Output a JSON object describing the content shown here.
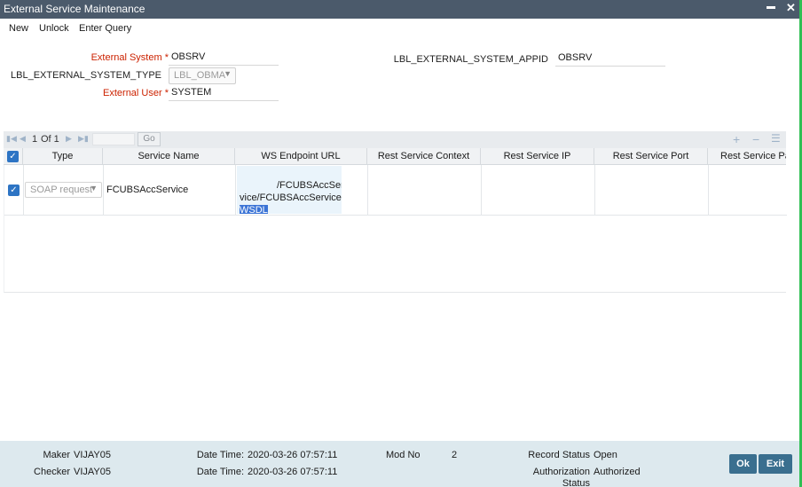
{
  "window": {
    "title": "External Service Maintenance",
    "minimize_glyph": "▬",
    "close_glyph": "✕"
  },
  "menu": {
    "new": "New",
    "unlock": "Unlock",
    "enter_query": "Enter Query"
  },
  "form": {
    "external_system_label": "External System",
    "external_system_value": "OBSRV",
    "system_type_label": "LBL_EXTERNAL_SYSTEM_TYPE",
    "system_type_value": "LBL_OBMA",
    "external_user_label": "External User",
    "external_user_value": "SYSTEM",
    "appid_label": "LBL_EXTERNAL_SYSTEM_APPID",
    "appid_value": "OBSRV",
    "required_marker": "*"
  },
  "grid": {
    "pager": {
      "current": "1",
      "of_text": "Of 1",
      "go_label": "Go"
    },
    "toolbar_icons": [
      "add-row-icon",
      "delete-row-icon",
      "view-list-icon"
    ],
    "columns": [
      "Type",
      "Service Name",
      "WS Endpoint URL",
      "Rest Service Context",
      "Rest Service IP",
      "Rest Service Port",
      "Rest Service Pat"
    ],
    "rows": [
      {
        "checked": true,
        "type": "SOAP request",
        "service_name": "FCUBSAccService",
        "url_line1": "/FCUBSAccSer",
        "url_line2": "vice/FCUBSAccService?",
        "url_line3": "WSDL",
        "rest_context": "",
        "rest_ip": "",
        "rest_port": "",
        "rest_path": ""
      }
    ]
  },
  "footer": {
    "maker_label": "Maker",
    "maker_value": "VIJAY05",
    "maker_dt_label": "Date Time:",
    "maker_dt_value": "2020-03-26 07:57:11",
    "checker_label": "Checker",
    "checker_value": "VIJAY05",
    "checker_dt_label": "Date Time:",
    "checker_dt_value": "2020-03-26 07:57:11",
    "mod_no_label": "Mod No",
    "mod_no_value": "2",
    "record_status_label": "Record Status",
    "record_status_value": "Open",
    "auth_status_label_1": "Authorization",
    "auth_status_label_2": "Status",
    "auth_status_value": "Authorized",
    "ok_label": "Ok",
    "exit_label": "Exit"
  },
  "colors": {
    "titlebar": "#4b5a6b",
    "required_label": "#cc2200",
    "checkbox": "#2d74c4",
    "footer_bg": "#dde9ee",
    "button_bg": "#3a6f8f",
    "selection": "#3b74d6"
  }
}
